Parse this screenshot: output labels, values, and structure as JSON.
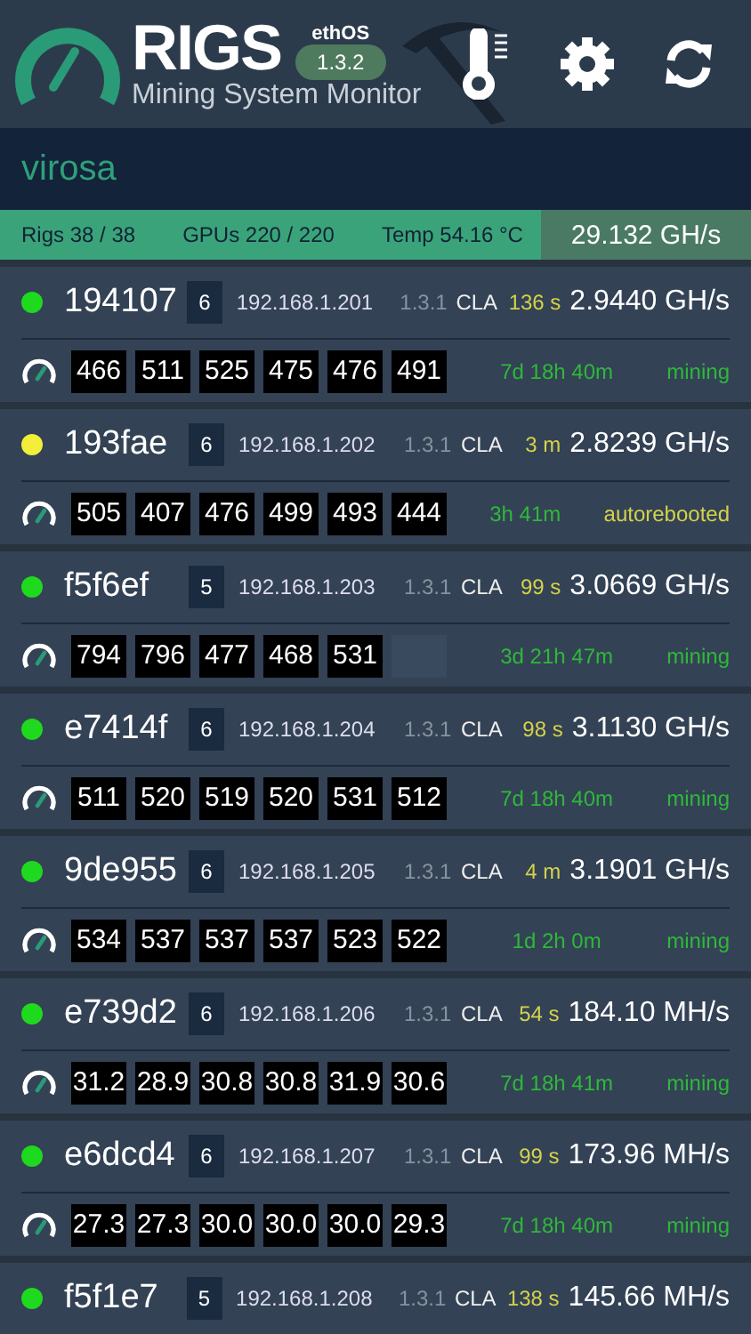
{
  "header": {
    "title": "RIGS",
    "os_label": "ethOS",
    "os_version": "1.3.2",
    "subtitle": "Mining System Monitor"
  },
  "farm": {
    "name": "virosa"
  },
  "summary": {
    "rigs": "Rigs 38 / 38",
    "gpus": "GPUs 220 / 220",
    "temp": "Temp 54.16 °C",
    "hashrate": "29.132 GH/s"
  },
  "rigs": [
    {
      "name": "194107",
      "color": "#1ed91e",
      "gpu_count": "6",
      "ip": "192.168.1.201",
      "version": "1.3.1",
      "miner": "CLA",
      "age": "136 s",
      "hashrate": "2.9440 GH/s",
      "gpus": [
        "466",
        "511",
        "525",
        "475",
        "476",
        "491"
      ],
      "uptime": "7d 18h 40m",
      "status": {
        "text": "mining",
        "kind": "ok"
      }
    },
    {
      "name": "193fae",
      "color": "#f2ee3a",
      "gpu_count": "6",
      "ip": "192.168.1.202",
      "version": "1.3.1",
      "miner": "CLA",
      "age": "3 m",
      "hashrate": "2.8239 GH/s",
      "gpus": [
        "505",
        "407",
        "476",
        "499",
        "493",
        "444"
      ],
      "uptime": "3h 41m",
      "status": {
        "text": "autorebooted",
        "kind": "warn"
      }
    },
    {
      "name": "f5f6ef",
      "color": "#1ed91e",
      "gpu_count": "5",
      "ip": "192.168.1.203",
      "version": "1.3.1",
      "miner": "CLA",
      "age": "99 s",
      "hashrate": "3.0669 GH/s",
      "gpus": [
        "794",
        "796",
        "477",
        "468",
        "531"
      ],
      "uptime": "3d 21h 47m",
      "status": {
        "text": "mining",
        "kind": "ok"
      }
    },
    {
      "name": "e7414f",
      "color": "#1ed91e",
      "gpu_count": "6",
      "ip": "192.168.1.204",
      "version": "1.3.1",
      "miner": "CLA",
      "age": "98 s",
      "hashrate": "3.1130 GH/s",
      "gpus": [
        "511",
        "520",
        "519",
        "520",
        "531",
        "512"
      ],
      "uptime": "7d 18h 40m",
      "status": {
        "text": "mining",
        "kind": "ok"
      }
    },
    {
      "name": "9de955",
      "color": "#1ed91e",
      "gpu_count": "6",
      "ip": "192.168.1.205",
      "version": "1.3.1",
      "miner": "CLA",
      "age": "4 m",
      "hashrate": "3.1901 GH/s",
      "gpus": [
        "534",
        "537",
        "537",
        "537",
        "523",
        "522"
      ],
      "uptime": "1d 2h 0m",
      "status": {
        "text": "mining",
        "kind": "ok"
      }
    },
    {
      "name": "e739d2",
      "color": "#1ed91e",
      "gpu_count": "6",
      "ip": "192.168.1.206",
      "version": "1.3.1",
      "miner": "CLA",
      "age": "54 s",
      "hashrate": "184.10 MH/s",
      "gpus": [
        "31.2",
        "28.9",
        "30.8",
        "30.8",
        "31.9",
        "30.6"
      ],
      "uptime": "7d 18h 41m",
      "status": {
        "text": "mining",
        "kind": "ok"
      }
    },
    {
      "name": "e6dcd4",
      "color": "#1ed91e",
      "gpu_count": "6",
      "ip": "192.168.1.207",
      "version": "1.3.1",
      "miner": "CLA",
      "age": "99 s",
      "hashrate": "173.96 MH/s",
      "gpus": [
        "27.3",
        "27.3",
        "30.0",
        "30.0",
        "30.0",
        "29.3"
      ],
      "uptime": "7d 18h 40m",
      "status": {
        "text": "mining",
        "kind": "ok"
      }
    },
    {
      "name": "f5f1e7",
      "color": "#1ed91e",
      "gpu_count": "5",
      "ip": "192.168.1.208",
      "version": "1.3.1",
      "miner": "CLA",
      "age": "138 s",
      "hashrate": "145.66 MH/s"
    }
  ]
}
